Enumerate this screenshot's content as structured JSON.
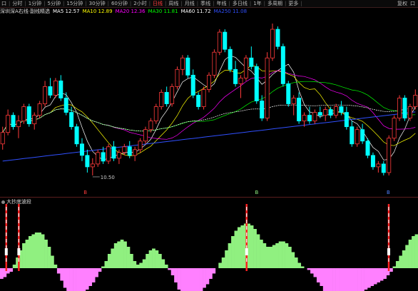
{
  "toolbar": {
    "items": [
      {
        "label": "口"
      },
      {
        "label": "分时"
      },
      {
        "label": "1分钟"
      },
      {
        "label": "5分钟"
      },
      {
        "label": "15分钟"
      },
      {
        "label": "30分钟"
      },
      {
        "label": "60分钟"
      },
      {
        "label": "2小时"
      },
      {
        "label": "日线",
        "active": true
      },
      {
        "label": "周线"
      },
      {
        "label": "月线"
      },
      {
        "label": "季线"
      },
      {
        "label": "年线"
      },
      {
        "label": "多日线"
      },
      {
        "label": "1年"
      },
      {
        "label": "多周期"
      },
      {
        "label": "更多"
      }
    ],
    "right_items": [
      {
        "label": "复权"
      },
      {
        "label": "口"
      }
    ]
  },
  "infobar": {
    "indicator_name": "深圳深A右线·副线精选",
    "ma5": "MA5 12.57",
    "ma10": "MA10 12.89",
    "ma20": "MA20 12.36",
    "ma30": "MA30 11.81",
    "ma60": "MA60 11.72",
    "ma250": "MA250 11.08"
  },
  "main_chart": {
    "low_label": "10.50",
    "markers": [
      "B",
      "B",
      "B"
    ]
  },
  "indicator": {
    "title": "大抄底波段"
  },
  "colors": {
    "up": "#ff3b3b",
    "down": "#00ffff",
    "ma5": "#ffffff",
    "ma10": "#ffff00",
    "ma20": "#ff00ff",
    "ma30": "#00ff00",
    "ma60": "#ffffff",
    "ma250": "#3050ff",
    "osc_pos": "#90f080",
    "osc_neg": "#ff80ff"
  },
  "chart_data": {
    "type": "candlestick",
    "candles": [
      [
        11.6,
        12.2,
        11.4,
        12.0
      ],
      [
        12.0,
        12.8,
        11.9,
        12.6
      ],
      [
        12.6,
        12.7,
        12.1,
        12.2
      ],
      [
        12.2,
        12.6,
        11.8,
        12.4
      ],
      [
        12.4,
        13.0,
        12.3,
        12.9
      ],
      [
        12.9,
        13.0,
        12.2,
        12.3
      ],
      [
        12.3,
        12.7,
        12.1,
        12.6
      ],
      [
        12.6,
        13.1,
        12.5,
        13.0
      ],
      [
        13.0,
        13.8,
        12.9,
        13.6
      ],
      [
        13.6,
        13.9,
        13.2,
        13.3
      ],
      [
        13.3,
        13.9,
        13.2,
        13.8
      ],
      [
        13.8,
        14.0,
        13.1,
        13.2
      ],
      [
        13.2,
        13.4,
        12.6,
        12.7
      ],
      [
        12.7,
        12.9,
        12.1,
        12.2
      ],
      [
        12.2,
        12.3,
        11.5,
        11.6
      ],
      [
        11.6,
        11.8,
        11.0,
        11.2
      ],
      [
        11.2,
        11.4,
        10.6,
        10.8
      ],
      [
        10.8,
        11.1,
        10.5,
        10.9
      ],
      [
        10.9,
        11.4,
        10.8,
        11.3
      ],
      [
        11.3,
        11.5,
        10.9,
        11.0
      ],
      [
        11.0,
        11.6,
        10.9,
        11.5
      ],
      [
        11.5,
        11.7,
        11.0,
        11.1
      ],
      [
        11.1,
        11.4,
        10.9,
        11.3
      ],
      [
        11.3,
        11.6,
        11.2,
        11.5
      ],
      [
        11.5,
        11.7,
        11.1,
        11.2
      ],
      [
        11.2,
        11.5,
        11.0,
        11.4
      ],
      [
        11.4,
        11.8,
        11.3,
        11.7
      ],
      [
        11.7,
        12.2,
        11.6,
        12.1
      ],
      [
        12.1,
        12.5,
        12.0,
        12.4
      ],
      [
        12.4,
        13.0,
        12.3,
        12.9
      ],
      [
        12.9,
        13.5,
        12.8,
        13.4
      ],
      [
        13.4,
        13.6,
        12.9,
        13.0
      ],
      [
        13.0,
        13.7,
        12.9,
        13.6
      ],
      [
        13.6,
        14.3,
        13.5,
        14.2
      ],
      [
        14.2,
        14.7,
        14.0,
        14.6
      ],
      [
        14.6,
        14.7,
        13.9,
        14.0
      ],
      [
        14.0,
        14.2,
        13.2,
        13.3
      ],
      [
        13.3,
        13.4,
        12.8,
        12.9
      ],
      [
        12.9,
        13.6,
        12.8,
        13.5
      ],
      [
        13.5,
        14.1,
        13.4,
        14.0
      ],
      [
        14.0,
        14.9,
        13.9,
        14.8
      ],
      [
        14.8,
        15.6,
        14.7,
        15.5
      ],
      [
        15.5,
        15.6,
        14.8,
        14.9
      ],
      [
        14.9,
        15.0,
        14.1,
        14.2
      ],
      [
        14.2,
        14.5,
        13.6,
        13.7
      ],
      [
        13.7,
        14.0,
        13.2,
        13.9
      ],
      [
        13.9,
        14.7,
        13.8,
        14.6
      ],
      [
        14.6,
        15.0,
        14.2,
        14.3
      ],
      [
        14.3,
        14.4,
        13.0,
        13.1
      ],
      [
        13.1,
        13.3,
        12.4,
        12.5
      ],
      [
        12.5,
        14.8,
        12.4,
        14.6
      ],
      [
        14.6,
        15.8,
        14.5,
        15.6
      ],
      [
        15.6,
        15.7,
        14.9,
        15.0
      ],
      [
        15.0,
        15.1,
        13.6,
        13.7
      ],
      [
        13.7,
        13.8,
        12.9,
        13.0
      ],
      [
        13.0,
        13.3,
        12.6,
        13.2
      ],
      [
        13.2,
        13.4,
        12.3,
        12.4
      ],
      [
        12.4,
        12.7,
        12.2,
        12.6
      ],
      [
        12.6,
        12.9,
        12.3,
        12.4
      ],
      [
        12.4,
        12.8,
        12.3,
        12.7
      ],
      [
        12.7,
        12.9,
        12.5,
        12.6
      ],
      [
        12.6,
        12.9,
        12.4,
        12.8
      ],
      [
        12.8,
        12.9,
        12.5,
        12.6
      ],
      [
        12.6,
        13.0,
        12.5,
        12.9
      ],
      [
        12.9,
        13.1,
        12.6,
        12.7
      ],
      [
        12.7,
        12.9,
        12.1,
        12.2
      ],
      [
        12.2,
        12.4,
        11.5,
        11.6
      ],
      [
        11.6,
        12.2,
        11.5,
        12.1
      ],
      [
        12.1,
        12.3,
        11.6,
        11.7
      ],
      [
        11.7,
        11.8,
        11.1,
        11.2
      ],
      [
        11.2,
        11.3,
        10.7,
        10.8
      ],
      [
        10.8,
        11.0,
        10.6,
        10.9
      ],
      [
        10.9,
        11.0,
        10.5,
        10.6
      ],
      [
        10.6,
        11.9,
        10.5,
        11.8
      ],
      [
        11.8,
        12.6,
        11.7,
        12.5
      ],
      [
        12.5,
        13.3,
        12.4,
        13.2
      ],
      [
        13.2,
        13.3,
        12.4,
        12.5
      ],
      [
        12.5,
        13.0,
        12.4,
        12.9
      ],
      [
        12.9,
        13.5,
        12.8,
        13.3
      ]
    ],
    "y_range": [
      10.3,
      16.0
    ],
    "indicator_hist": [
      -6,
      -5,
      -3,
      -2,
      2,
      6,
      10,
      14,
      16,
      18,
      19,
      20,
      20,
      19,
      16,
      12,
      7,
      2,
      -3,
      -7,
      -11,
      -14,
      -16,
      -17,
      -17,
      -16,
      -14,
      -12,
      -10,
      -8,
      -5,
      -2,
      1,
      4,
      8,
      11,
      14,
      15,
      16,
      15,
      12,
      8,
      4,
      2,
      3,
      5,
      8,
      10,
      11,
      10,
      8,
      5,
      2,
      -1,
      -4,
      -8,
      -12,
      -15,
      -16,
      -17,
      -17,
      -16,
      -15,
      -13,
      -11,
      -9,
      -6,
      -3,
      0,
      3,
      6,
      10,
      14,
      18,
      21,
      23,
      24,
      25,
      25,
      24,
      22,
      19,
      16,
      14,
      12,
      12,
      13,
      14,
      15,
      15,
      14,
      12,
      9,
      6,
      3,
      1,
      0,
      -1,
      -3,
      -5,
      -8,
      -10,
      -13,
      -15,
      -17,
      -18,
      -19,
      -20,
      -20,
      -19,
      -18,
      -16,
      -15,
      -14,
      -13,
      -12,
      -11,
      -10,
      -9,
      -8,
      -7,
      -6,
      -4,
      -2,
      1,
      4,
      7,
      10,
      13,
      16,
      18,
      19
    ],
    "signal_positions": [
      0.015,
      0.045,
      0.59,
      0.93
    ]
  }
}
